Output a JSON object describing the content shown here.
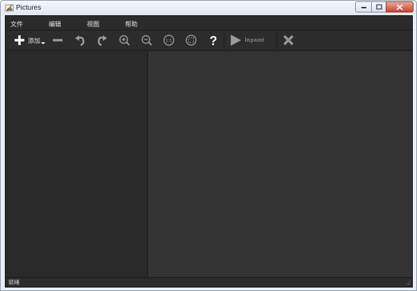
{
  "window": {
    "title": "Pictures"
  },
  "menu": {
    "items": [
      {
        "label": "文件"
      },
      {
        "label": "编辑"
      },
      {
        "label": "视图"
      },
      {
        "label": "帮助"
      }
    ]
  },
  "toolbar": {
    "add_label": "添加",
    "inpaint_label": "Inpaint",
    "icons": {
      "add": "plus-icon",
      "remove": "minus-icon",
      "undo": "undo-icon",
      "redo": "redo-icon",
      "zoom_in": "zoom-in-icon",
      "zoom_out": "zoom-out-icon",
      "actual_size": "zoom-1to1-icon",
      "fit": "zoom-fit-icon",
      "help": "help-icon",
      "run": "play-icon",
      "cancel": "close-icon"
    },
    "add_actual_size_text": "1:1"
  },
  "status": {
    "text": "就绪"
  },
  "colors": {
    "background": "#2a2a2a",
    "canvas": "#333333",
    "text": "#e6e6e6",
    "icon": "#ffffff",
    "icon_dim": "#9a9a9a"
  }
}
